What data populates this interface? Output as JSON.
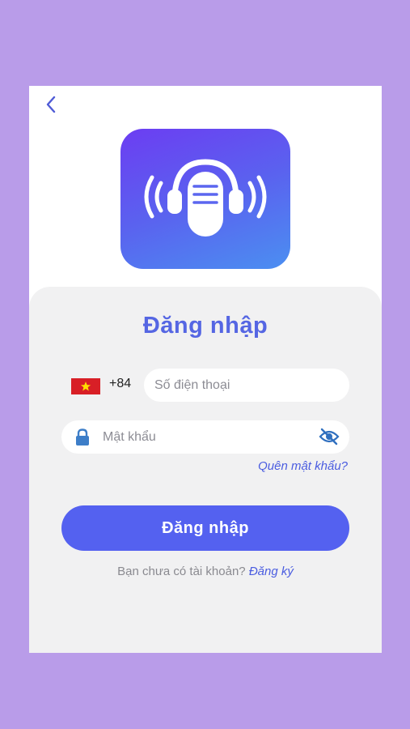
{
  "icons": {
    "back": "chevron-left-icon",
    "logo": "headphones-microphone-icon",
    "flag": "vietnam-flag-icon",
    "lock": "lock-icon",
    "eye": "eye-off-icon"
  },
  "colors": {
    "background": "#b99ce9",
    "accent": "#5461f0",
    "link": "#4a5ce0",
    "card": "#f1f1f2"
  },
  "login": {
    "title": "Đăng nhập",
    "country_code": "+84",
    "phone_placeholder": "Số điện thoại",
    "password_placeholder": "Mật khẩu",
    "forgot_password": "Quên mật khẩu?",
    "submit_label": "Đăng nhập",
    "no_account_text": "Bạn chưa có tài khoản?",
    "signup_link": "Đăng ký"
  }
}
